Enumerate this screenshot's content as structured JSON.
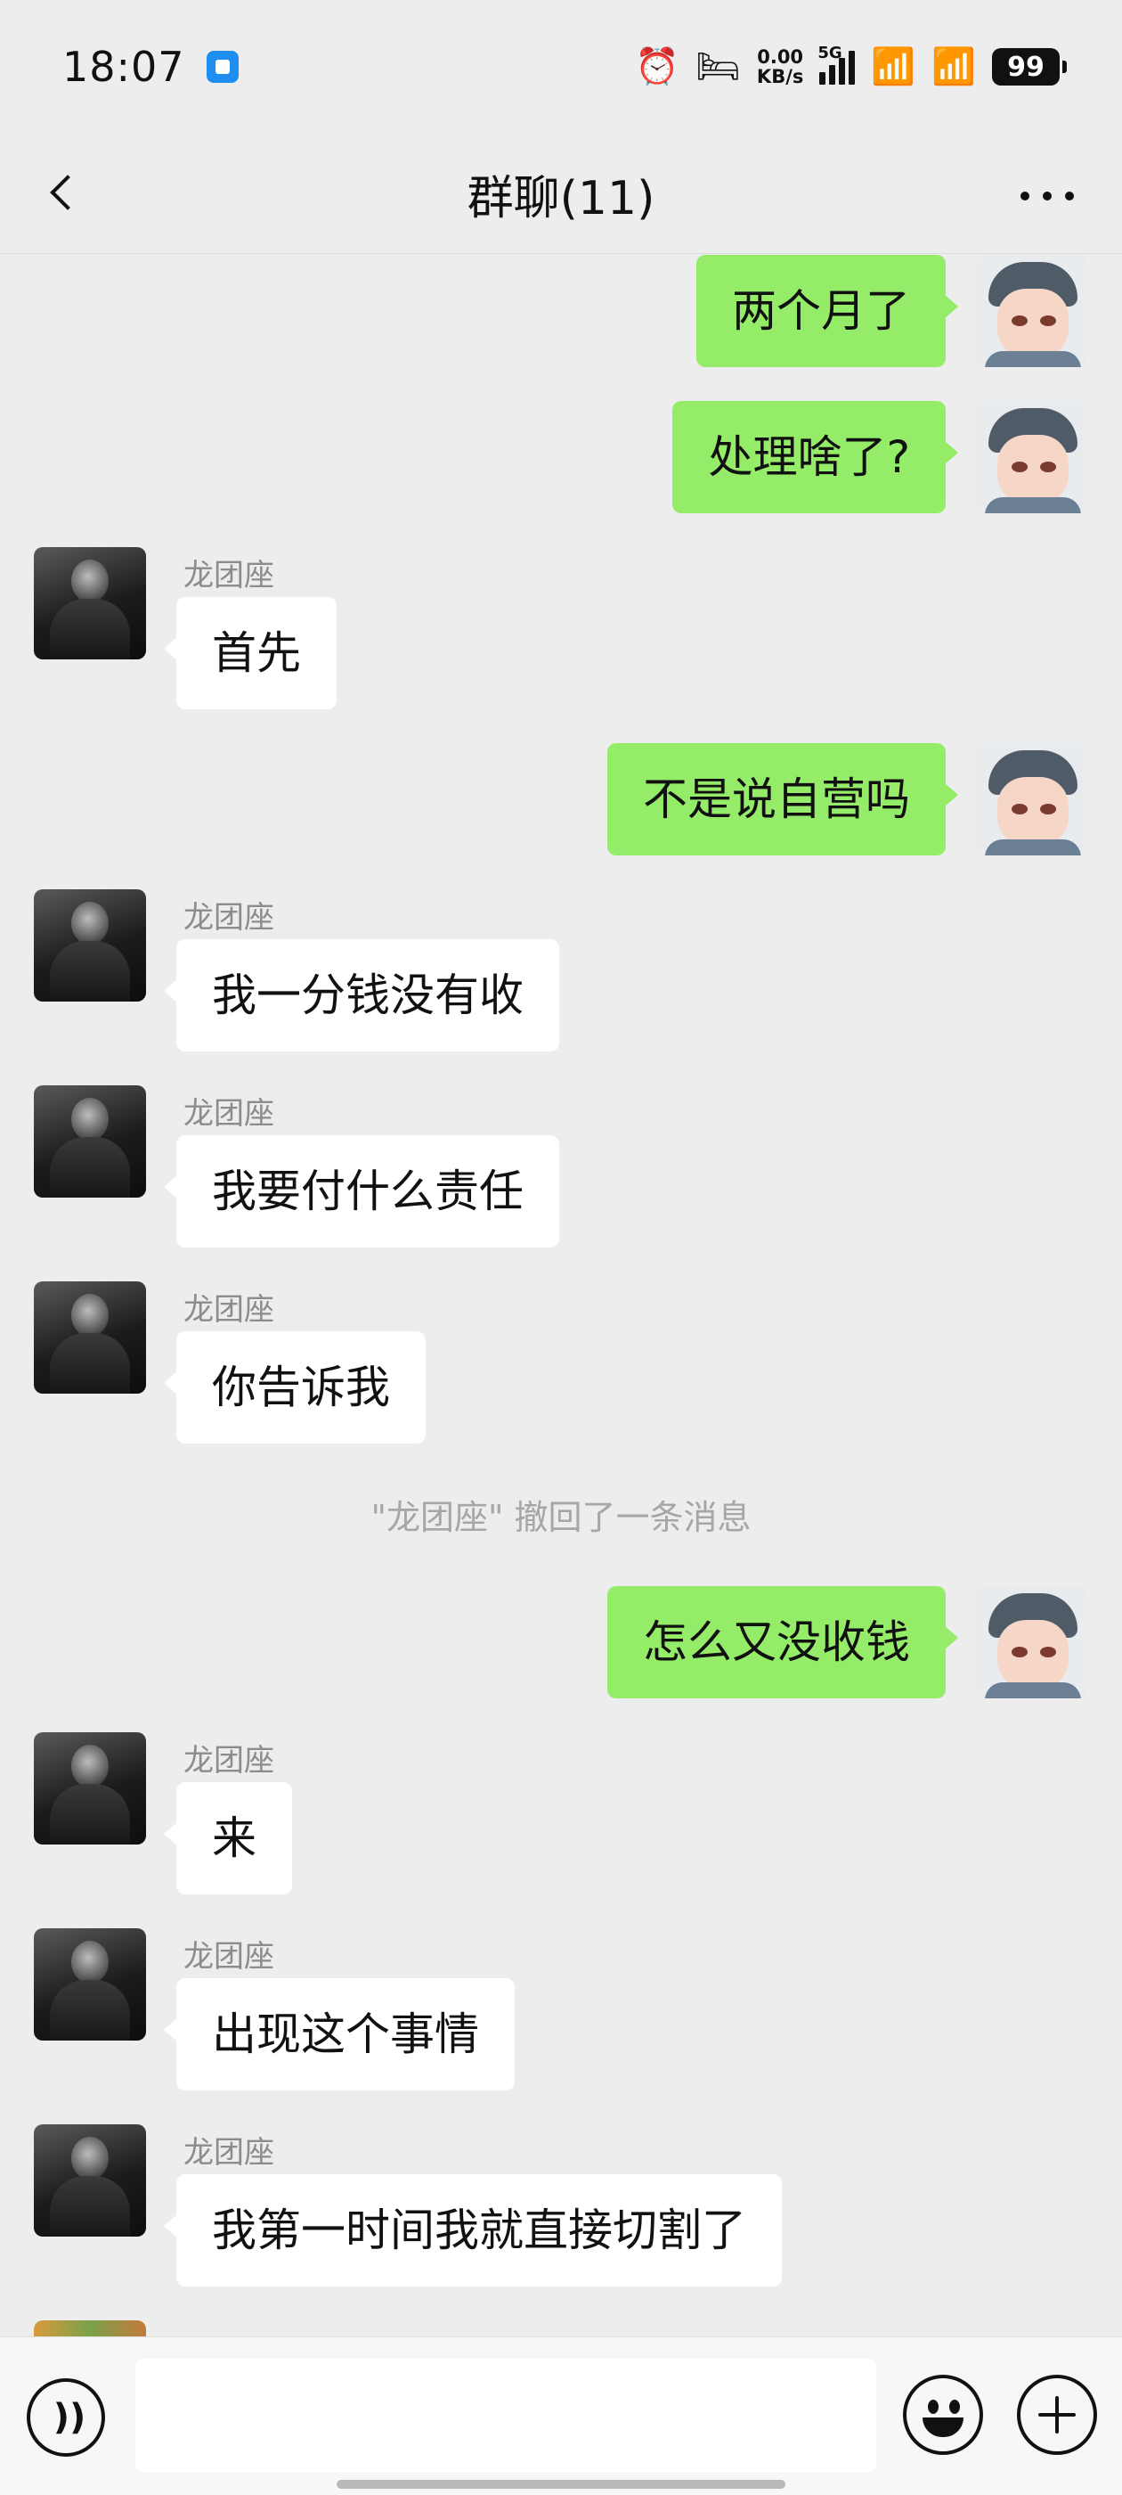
{
  "status_bar": {
    "time": "18:07",
    "net_speed_value": "0.00",
    "net_speed_unit": "KB/s",
    "network_type": "5G",
    "battery": "99"
  },
  "header": {
    "title": "群聊(11)"
  },
  "messages": [
    {
      "direction": "out",
      "text": "两个月了"
    },
    {
      "direction": "out",
      "text": "处理啥了?"
    },
    {
      "direction": "in",
      "sender": "龙团座",
      "text": "首先"
    },
    {
      "direction": "out",
      "text": "不是说自营吗"
    },
    {
      "direction": "in",
      "sender": "龙团座",
      "text": "我一分钱没有收"
    },
    {
      "direction": "in",
      "sender": "龙团座",
      "text": "我要付什么责任"
    },
    {
      "direction": "in",
      "sender": "龙团座",
      "text": "你告诉我"
    },
    {
      "direction": "system",
      "text": "\"龙团座\" 撤回了一条消息"
    },
    {
      "direction": "out",
      "text": "怎么又没收钱"
    },
    {
      "direction": "in",
      "sender": "龙团座",
      "text": "来"
    },
    {
      "direction": "in",
      "sender": "龙团座",
      "text": "出现这个事情"
    },
    {
      "direction": "in",
      "sender": "龙团座",
      "text": "我第一时间我就直接切割了"
    }
  ],
  "input_bar": {
    "message_value": "",
    "voice_icon": "voice-icon",
    "emoji_icon": "emoji-icon",
    "plus_icon": "plus-icon"
  },
  "colors": {
    "outgoing_bubble": "#95ec69",
    "incoming_bubble": "#ffffff",
    "background": "#ededed"
  }
}
